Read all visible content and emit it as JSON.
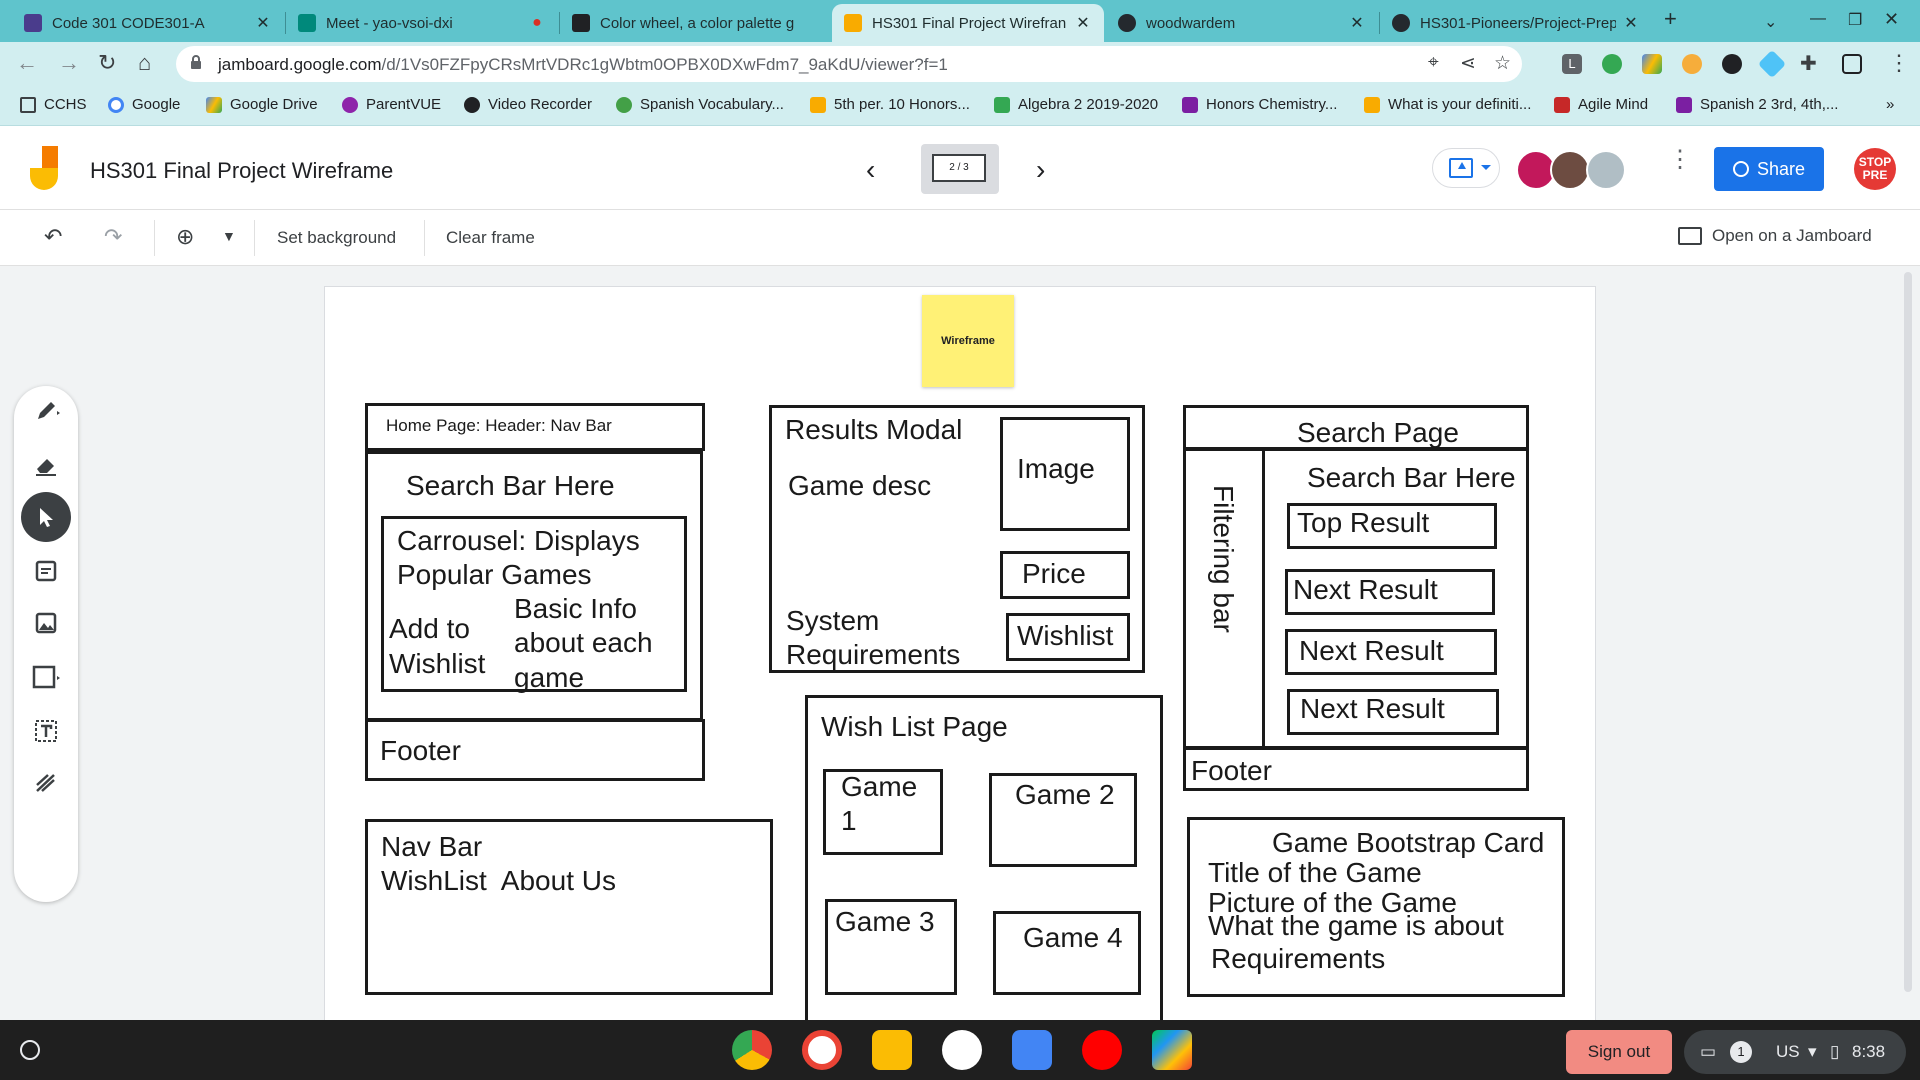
{
  "browser": {
    "tabs": [
      {
        "title": "Code 301 CODE301-A",
        "active": false
      },
      {
        "title": "Meet - yao-vsoi-dxi",
        "active": false
      },
      {
        "title": "Color wheel, a color palette g",
        "active": false
      },
      {
        "title": "HS301 Final Project Wirefran",
        "active": true
      },
      {
        "title": "woodwardem",
        "active": false
      },
      {
        "title": "HS301-Pioneers/Project-Prep",
        "active": false
      }
    ],
    "new_tab_symbol": "+",
    "url_host": "jamboard.google.com",
    "url_path": "/d/1Vs0FZFpyCRsMrtVDRc1gWbtm0OPBX0DXwFdm7_9aKdU/viewer?f=1",
    "extension_letter": "L",
    "bookmarks": [
      "CCHS",
      "Google",
      "Google Drive",
      "ParentVUE",
      "Video Recorder",
      "Spanish Vocabulary...",
      "5th per. 10 Honors...",
      "Algebra 2 2019-2020",
      "Honors Chemistry...",
      "What is your definiti...",
      "Agile Mind",
      "Spanish 2 3rd, 4th,..."
    ],
    "bookmarks_overflow": "»"
  },
  "jamboard": {
    "title": "HS301 Final Project Wireframe",
    "frame_indicator": "2 / 3",
    "share_label": "Share",
    "stop_badge": "STOP PRE",
    "toolbar": {
      "set_background": "Set background",
      "clear_frame": "Clear frame",
      "open_on_jamboard": "Open on a Jamboard"
    },
    "board": {
      "sticky_note": "Wireframe",
      "home": {
        "header": "Home Page: Header: Nav Bar",
        "search": "Search Bar Here",
        "carousel_line1": "Carrousel: Displays",
        "carousel_line2": "Popular Games",
        "add_line1": "Add to",
        "add_line2": "Wishlist",
        "info_line1": "Basic Info",
        "info_line2": "about each",
        "info_line3": "game",
        "footer": "Footer"
      },
      "navbar": {
        "title": "Nav Bar",
        "links": "WishList  About Us"
      },
      "results": {
        "title": "Results Modal",
        "desc": "Game desc",
        "image": "Image",
        "price": "Price",
        "req_line1": "System",
        "req_line2": "Requirements",
        "wishlist": "Wishlist"
      },
      "wishlist": {
        "title": "Wish List Page",
        "game1_line1": "Game",
        "game1_line2": "1",
        "game2": "Game 2",
        "game3": "Game 3",
        "game4": "Game 4"
      },
      "search": {
        "title": "Search Page",
        "search_bar": "Search Bar Here",
        "filter": "Filtering bar",
        "top": "Top Result",
        "next1": "Next Result",
        "next2": "Next Result",
        "next3": "Next Result",
        "footer": "Footer"
      },
      "card": {
        "title": "Game Bootstrap Card",
        "line1": "Title of the Game",
        "line2": "Picture of the Game",
        "line3": "What the game is about",
        "line4": "Requirements"
      }
    }
  },
  "shelf": {
    "sign_out": "Sign out",
    "notifications": "1",
    "locale": "US",
    "time": "8:38"
  }
}
